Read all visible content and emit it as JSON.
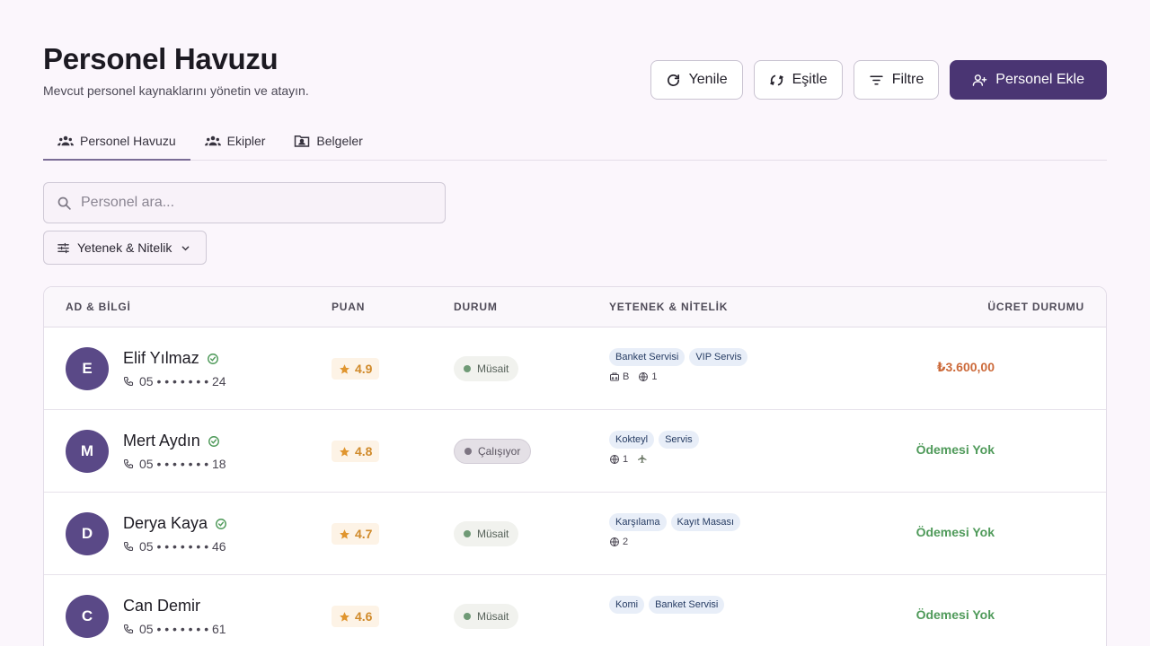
{
  "header": {
    "title": "Personel Havuzu",
    "subtitle": "Mevcut personel kaynaklarını yönetin ve atayın.",
    "buttons": {
      "refresh": "Yenile",
      "sync": "Eşitle",
      "filter": "Filtre",
      "add": "Personel Ekle"
    }
  },
  "tabs": [
    {
      "label": "Personel Havuzu",
      "icon": "group-icon",
      "active": true
    },
    {
      "label": "Ekipler",
      "icon": "group-icon",
      "active": false
    },
    {
      "label": "Belgeler",
      "icon": "folder-user-icon",
      "active": false
    }
  ],
  "search": {
    "placeholder": "Personel ara...",
    "value": ""
  },
  "filter_chip": {
    "label": "Yetenek & Nitelik"
  },
  "table": {
    "columns": {
      "name": "AD & BİLGİ",
      "rating": "PUAN",
      "status": "DURUM",
      "skills": "YETENEK & NİTELİK",
      "fee": "ÜCRET DURUMU"
    },
    "rows": [
      {
        "initial": "E",
        "name": "Elif Yılmaz",
        "verified": true,
        "phone": "05 • • • • • • • 24",
        "rating": "4.9",
        "status": "Müsait",
        "status_type": "avail",
        "tags": [
          "Banket Servisi",
          "VIP Servis"
        ],
        "meta": {
          "license": "B",
          "languages": "1",
          "travel": false
        },
        "fee": "₺3.600,00",
        "fee_type": "amount"
      },
      {
        "initial": "M",
        "name": "Mert Aydın",
        "verified": true,
        "phone": "05 • • • • • • • 18",
        "rating": "4.8",
        "status": "Çalışıyor",
        "status_type": "busy",
        "tags": [
          "Kokteyl",
          "Servis"
        ],
        "meta": {
          "license": "",
          "languages": "1",
          "travel": true
        },
        "fee": "Ödemesi Yok",
        "fee_type": "none"
      },
      {
        "initial": "D",
        "name": "Derya Kaya",
        "verified": true,
        "phone": "05 • • • • • • • 46",
        "rating": "4.7",
        "status": "Müsait",
        "status_type": "avail",
        "tags": [
          "Karşılama",
          "Kayıt Masası"
        ],
        "meta": {
          "license": "",
          "languages": "2",
          "travel": false
        },
        "fee": "Ödemesi Yok",
        "fee_type": "none"
      },
      {
        "initial": "C",
        "name": "Can Demir",
        "verified": false,
        "phone": "05 • • • • • • • 61",
        "rating": "4.6",
        "status": "Müsait",
        "status_type": "avail",
        "tags": [
          "Komi",
          "Banket Servisi"
        ],
        "meta": {
          "license": "",
          "languages": "",
          "travel": false
        },
        "fee": "Ödemesi Yok",
        "fee_type": "none"
      }
    ]
  },
  "colors": {
    "primary": "#4a3573",
    "avatar": "#5a4987",
    "fee_amount": "#cc6a3a",
    "fee_none": "#4f9a5a",
    "rating": "#d08a2a"
  }
}
